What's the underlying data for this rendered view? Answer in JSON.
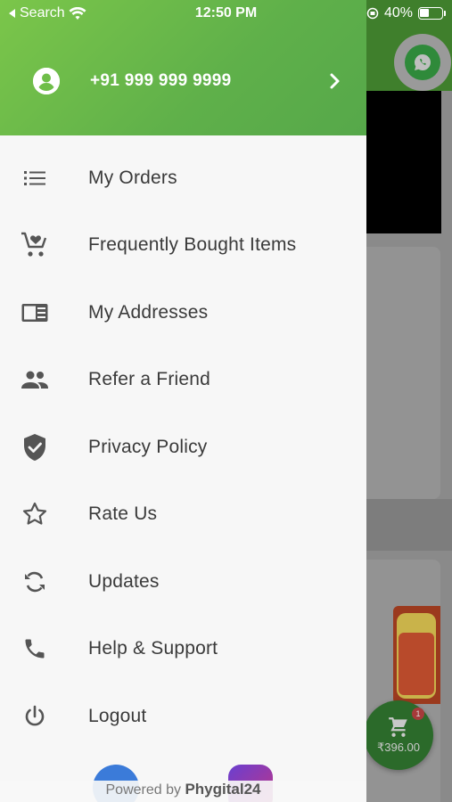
{
  "status_bar": {
    "back_app": "Search",
    "time": "12:50 PM",
    "battery": "40%"
  },
  "profile": {
    "phone": "+91 999 999 9999"
  },
  "menu": {
    "items": [
      {
        "label": "My Orders",
        "icon": "list-icon"
      },
      {
        "label": "Frequently Bought Items",
        "icon": "cart-heart-icon"
      },
      {
        "label": "My Addresses",
        "icon": "address-card-icon"
      },
      {
        "label": "Refer a Friend",
        "icon": "people-icon"
      },
      {
        "label": "Privacy Policy",
        "icon": "shield-check-icon"
      },
      {
        "label": "Rate Us",
        "icon": "star-icon"
      },
      {
        "label": "Updates",
        "icon": "sync-icon"
      },
      {
        "label": "Help & Support",
        "icon": "phone-icon"
      },
      {
        "label": "Logout",
        "icon": "power-icon"
      }
    ]
  },
  "footer": {
    "prefix": "Powered by",
    "brand": "Phygital24"
  },
  "background": {
    "cart_badge": "1",
    "cart_total": "₹396.00"
  },
  "colors": {
    "header_green": "#6fbe49",
    "icon_gray": "#555555",
    "text": "#3a3a3a"
  }
}
